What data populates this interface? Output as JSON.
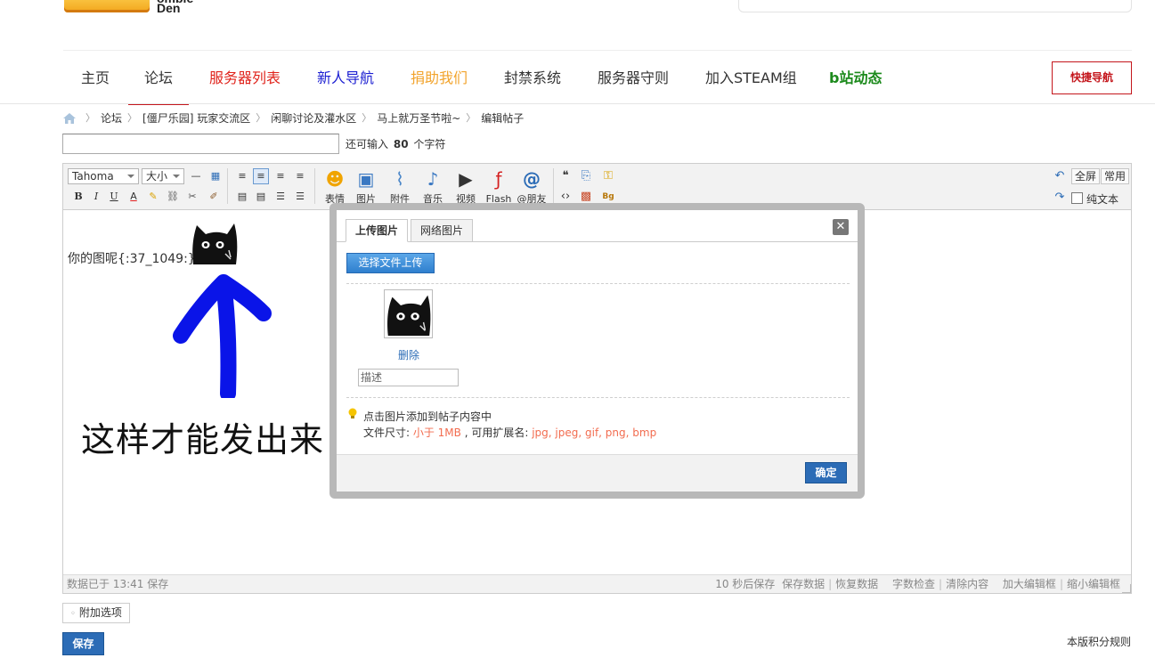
{
  "logo": {
    "text": "ombie\nDen"
  },
  "nav": {
    "items": [
      {
        "label": "主页",
        "color": "#333333"
      },
      {
        "label": "论坛",
        "color": "#333333",
        "active": true
      },
      {
        "label": "服务器列表",
        "color": "#e0231b"
      },
      {
        "label": "新人导航",
        "color": "#1c1fd2"
      },
      {
        "label": "捐助我们",
        "color": "#f2a32b"
      },
      {
        "label": "封禁系统",
        "color": "#333333"
      },
      {
        "label": "服务器守则",
        "color": "#333333"
      },
      {
        "label": "加入STEAM组",
        "color": "#333333"
      },
      {
        "label": "b站动态",
        "color": "#1c8a1c"
      }
    ],
    "quick_nav": "快捷导航"
  },
  "breadcrumb": [
    "论坛",
    "[僵尸乐园] 玩家交流区",
    "闲聊讨论及灌水区",
    "马上就万圣节啦~",
    "编辑帖子"
  ],
  "title_field": {
    "value": "",
    "hint_prefix": "还可输入",
    "remaining": "80",
    "hint_suffix": "个字符"
  },
  "toolbar": {
    "font": "Tahoma",
    "size": "大小",
    "buttons": [
      {
        "label": "表情",
        "icon": "smiley-icon"
      },
      {
        "label": "图片",
        "icon": "image-icon"
      },
      {
        "label": "附件",
        "icon": "paperclip-icon"
      },
      {
        "label": "音乐",
        "icon": "music-icon"
      },
      {
        "label": "视频",
        "icon": "video-icon"
      },
      {
        "label": "Flash",
        "icon": "flash-icon"
      },
      {
        "label": "@朋友",
        "icon": "at-icon"
      }
    ],
    "fullscreen": "全屏",
    "common": "常用",
    "plain_text": "纯文本"
  },
  "editor": {
    "line1": "你的图呢{:37_1049:}",
    "big_text": "这样才能发出来"
  },
  "status": {
    "saved": "数据已于 13:41 保存",
    "autosave": "10 秒后保存",
    "links": [
      "保存数据",
      "恢复数据",
      "字数检查",
      "清除内容",
      "加大编辑框",
      "缩小编辑框"
    ]
  },
  "extra_options": "附加选项",
  "save": "保存",
  "rules": "本版积分规则",
  "dialog": {
    "tabs": [
      "上传图片",
      "网络图片"
    ],
    "upload_button": "选择文件上传",
    "delete": "删除",
    "desc_placeholder": "描述",
    "tip1": "点击图片添加到帖子内容中",
    "tip2_prefix": "文件尺寸: ",
    "tip2_size": "小于 1MB",
    "tip2_mid": " , 可用扩展名: ",
    "tip2_ext": "jpg, jpeg, gif, png, bmp",
    "ok": "确定"
  }
}
